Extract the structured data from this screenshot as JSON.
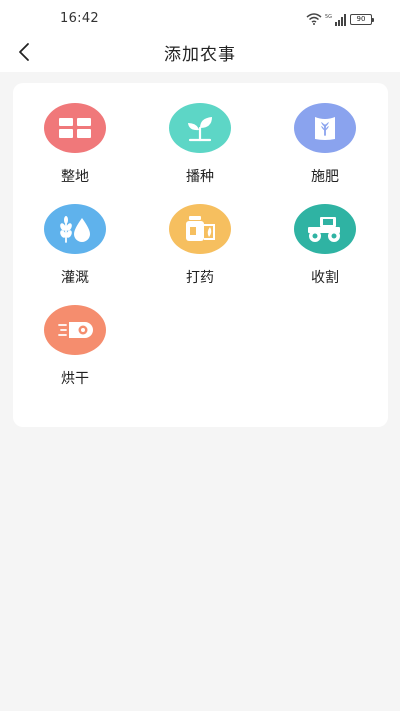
{
  "status": {
    "time": "16:42",
    "network": "5G",
    "battery": "90"
  },
  "header": {
    "title": "添加农事"
  },
  "items": [
    {
      "label": "整地",
      "icon": "field-icon",
      "color": "#f0787a"
    },
    {
      "label": "播种",
      "icon": "sprout-icon",
      "color": "#5dd6c6"
    },
    {
      "label": "施肥",
      "icon": "fertilizer-bag-icon",
      "color": "#8aa3ee"
    },
    {
      "label": "灌溉",
      "icon": "irrigation-drop-icon",
      "color": "#5fb2ec"
    },
    {
      "label": "打药",
      "icon": "pesticide-bottle-icon",
      "color": "#f6bf5f"
    },
    {
      "label": "收割",
      "icon": "tractor-icon",
      "color": "#2fb3a3"
    },
    {
      "label": "烘干",
      "icon": "dryer-icon",
      "color": "#f58d6e"
    }
  ]
}
